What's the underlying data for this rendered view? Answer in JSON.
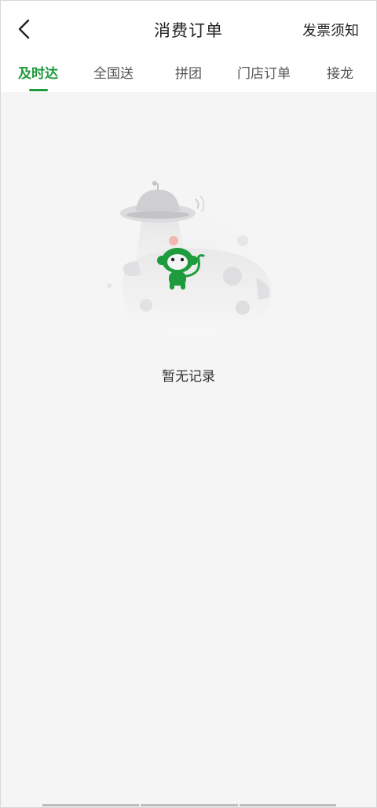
{
  "header": {
    "title": "消费订单",
    "invoice_link": "发票须知"
  },
  "tabs": [
    {
      "label": "及时达",
      "active": true
    },
    {
      "label": "全国送",
      "active": false
    },
    {
      "label": "拼团",
      "active": false
    },
    {
      "label": "门店订单",
      "active": false
    },
    {
      "label": "接龙",
      "active": false
    }
  ],
  "empty_state": {
    "message": "暂无记录",
    "illustration": "monkey-on-moon-with-ufo"
  },
  "colors": {
    "accent": "#1e9b3c",
    "background": "#f5f5f5"
  }
}
